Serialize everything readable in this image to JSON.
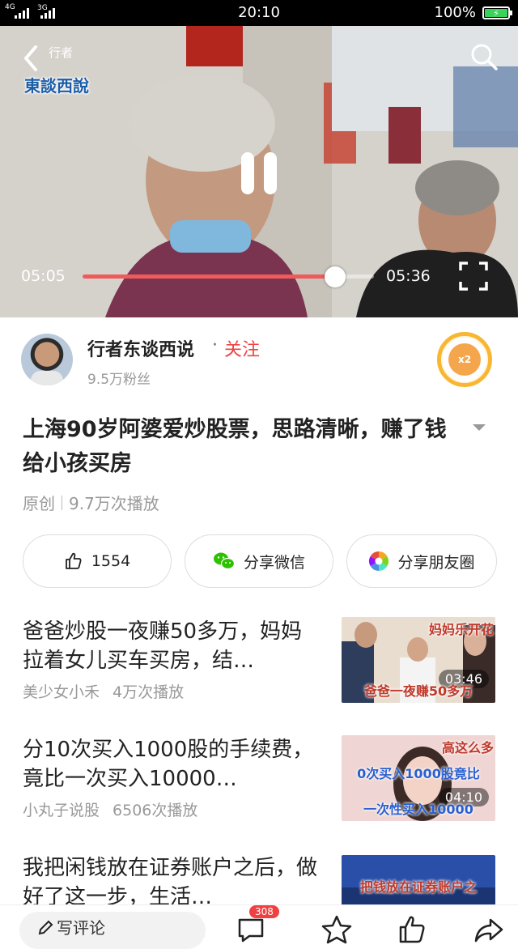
{
  "status_bar": {
    "network1": "4G",
    "network2": "3G",
    "time": "20:10",
    "battery": "100%"
  },
  "video": {
    "channel_logo_top": "行者",
    "channel_logo_bottom": "東談西說",
    "current_time": "05:05",
    "duration": "05:36",
    "progress": 0.866
  },
  "author": {
    "name": "行者东谈西说",
    "separator": "·",
    "follow_label": "关注",
    "fans": "9.5万粉丝",
    "coin_label": "x2"
  },
  "article": {
    "title": "上海90岁阿婆爱炒股票，思路清晰，赚了钱给小孩买房",
    "tag": "原创",
    "plays": "9.7万次播放"
  },
  "actions": {
    "like_count": "1554",
    "share_wechat": "分享微信",
    "share_moments": "分享朋友圈"
  },
  "related": [
    {
      "title": "爸爸炒股一夜赚50多万，妈妈拉着女儿买车买房，结…",
      "author": "美少女小禾",
      "views": "4万次播放",
      "duration": "03:46",
      "thumb_top": "妈妈乐开花",
      "thumb_caption": "爸爸一夜赚50多万"
    },
    {
      "title": "分10次买入1000股的手续费，竟比一次买入10000…",
      "author": "小丸子说股",
      "views": "6506次播放",
      "duration": "04:10",
      "thumb_top": "高这么多",
      "thumb_caption": "0次买入1000股竟比",
      "thumb_caption2": "一次性买入10000"
    },
    {
      "title": "我把闲钱放在证券账户之后，做好了这一步，生活…",
      "thumb_caption": "把钱放在证券账户之"
    }
  ],
  "bottom_bar": {
    "comment_placeholder": "写评论",
    "comment_count": "308"
  },
  "colors": {
    "accent_red": "#f04142",
    "progress_red": "#f05a5a",
    "coin_orange": "#f8b733"
  },
  "icons": [
    "back-icon",
    "search-icon",
    "pause-icon",
    "fullscreen-icon",
    "thumbs-up-icon",
    "wechat-icon",
    "moments-icon",
    "pen-icon",
    "comment-icon",
    "star-icon",
    "like-icon",
    "share-icon"
  ]
}
